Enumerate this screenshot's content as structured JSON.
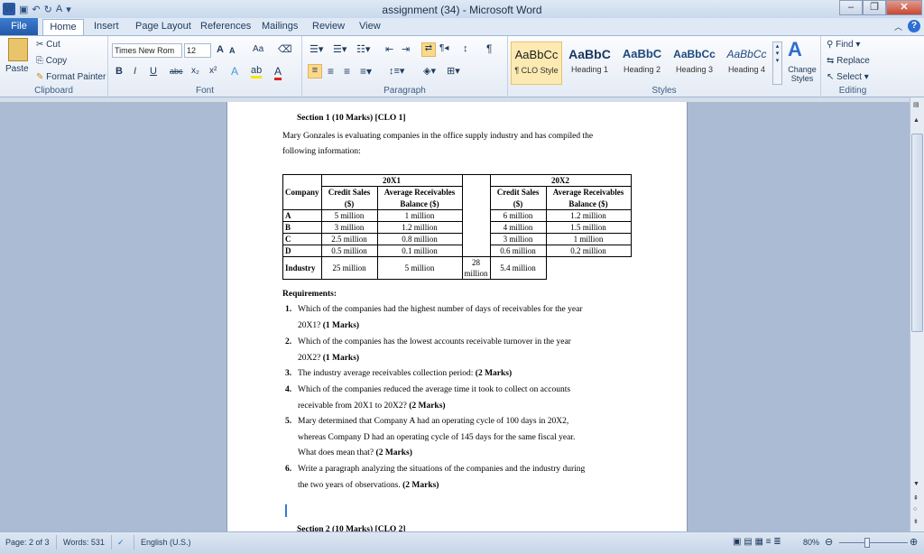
{
  "window": {
    "title": "assignment (34)  -  Microsoft Word"
  },
  "qat": {
    "logo": "W",
    "save": "save-icon",
    "undo": "undo-icon",
    "redo": "redo-icon",
    "spell": "A",
    "more": "▾"
  },
  "tabs": [
    "File",
    "Home",
    "Insert",
    "Page Layout",
    "References",
    "Mailings",
    "Review",
    "View"
  ],
  "ribbon": {
    "clipboard": {
      "paste": "Paste",
      "cut": "Cut",
      "copy": "Copy",
      "format_painter": "Format Painter",
      "label": "Clipboard"
    },
    "font": {
      "name": "Times New Rom",
      "size": "12",
      "grow": "A",
      "shrink": "A",
      "case": "Aa",
      "bold": "B",
      "italic": "I",
      "underline": "U",
      "strike": "abc",
      "sub": "x₂",
      "sup": "x²",
      "label": "Font"
    },
    "paragraph": {
      "label": "Paragraph",
      "pilcrow": "¶"
    },
    "styles": {
      "items": [
        {
          "sample": "AaBbCc",
          "name": "¶ CLO Style"
        },
        {
          "sample": "AaBbC",
          "name": "Heading 1"
        },
        {
          "sample": "AaBbC",
          "name": "Heading 2"
        },
        {
          "sample": "AaBbCc",
          "name": "Heading 3"
        },
        {
          "sample": "AaBbCc",
          "name": "Heading 4"
        }
      ],
      "change": "Change Styles",
      "label": "Styles"
    },
    "editing": {
      "find": "Find",
      "replace": "Replace",
      "select": "Select",
      "label": "Editing"
    }
  },
  "doc": {
    "heading": "Section 1 (10 Marks) [CLO 1]",
    "intro1": "Mary Gonzales is evaluating companies in the office supply industry and has compiled the",
    "intro2": "following information:",
    "table": {
      "year1": "20X1",
      "year2": "20X2",
      "company_header": "Company",
      "credit_sales": "Credit Sales",
      "dollar": "($)",
      "avg_rec": "Average Receivables",
      "balance": "Balance ($)",
      "rows": [
        [
          "A",
          "5 million",
          "1 million",
          "6 million",
          "1.2 million"
        ],
        [
          "B",
          "3 million",
          "1.2 million",
          "4 million",
          "1.5 million"
        ],
        [
          "C",
          "2.5 million",
          "0.8 million",
          "3 million",
          "1 million"
        ],
        [
          "D",
          "0.5 million",
          "0.1 million",
          "0.6 million",
          "0.2 million"
        ],
        [
          "Industry",
          "25 million",
          "5 million",
          "28 million",
          "5.4 million"
        ]
      ]
    },
    "requirements_title": "Requirements:",
    "requirements": [
      {
        "num": "1.",
        "line1": "Which of the companies had the highest number of days of receivables for the year",
        "line2": "20X1? ",
        "marks": "(1 Marks)"
      },
      {
        "num": "2.",
        "line1": "Which of the companies has the lowest accounts receivable turnover in the year",
        "line2": "20X2? ",
        "marks": "(1 Marks)"
      },
      {
        "num": "3.",
        "line1": "The industry average receivables collection period: ",
        "line1_marks": "(2 Marks)"
      },
      {
        "num": "4.",
        "line1": "Which of the companies reduced the average time it took to collect on accounts",
        "line2": "receivable from 20X1 to 20X2? ",
        "marks": "(2 Marks)"
      },
      {
        "num": "5.",
        "line1": "Mary determined that Company A had an operating cycle of 100 days in 20X2,",
        "line2": "whereas Company D had an operating cycle of 145 days for the same fiscal year.",
        "line3": "What does mean that? ",
        "marks": "(2 Marks)"
      },
      {
        "num": "6.",
        "line1": "Write a paragraph analyzing the situations of the companies and the industry during",
        "line2": "the two years of observations. ",
        "marks": "(2 Marks)"
      }
    ],
    "next_section": "Section 2 (10 Marks) [CLO 2]"
  },
  "status": {
    "page": "Page: 2 of 3",
    "words": "Words: 531",
    "language": "English (U.S.)",
    "zoom": "80%"
  },
  "colors": {
    "file_tab": "#2a62b8",
    "ribbon_bg": "#e4ebf5",
    "workspace": "#abbbd4"
  }
}
